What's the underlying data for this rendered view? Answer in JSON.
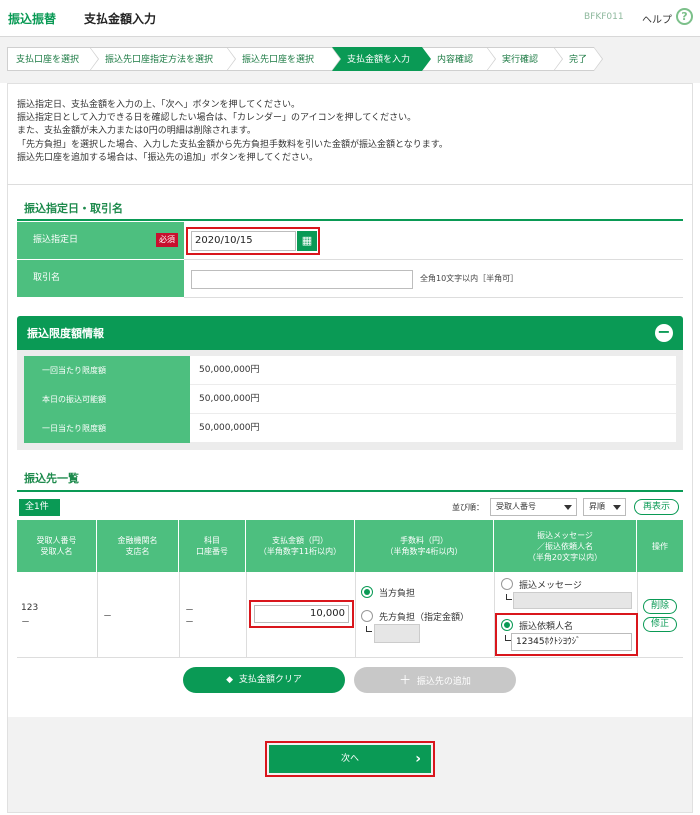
{
  "header": {
    "brand": "振込振替",
    "title": "支払金額入力",
    "screen_id": "BFKF011",
    "help_label": "ヘルプ",
    "help_icon": "?"
  },
  "steps": [
    {
      "label": "支払口座を選択"
    },
    {
      "label": "振込先口座指定方法を選択"
    },
    {
      "label": "振込先口座を選択"
    },
    {
      "label": "支払金額を入力"
    },
    {
      "label": "内容確認"
    },
    {
      "label": "実行確認"
    },
    {
      "label": "完了"
    }
  ],
  "description": [
    "振込指定日、支払金額を入力の上、「次へ」ボタンを押してください。",
    "振込指定日として入力できる日を確認したい場合は、「カレンダー」のアイコンを押してください。",
    "また、支払金額が未入力または0円の明細は削除されます。",
    "「先方負担」を選択した場合、入力した支払金額から先方負担手数料を引いた金額が振込金額となります。",
    "振込先口座を追加する場合は、「振込先の追加」ボタンを押してください。"
  ],
  "date_section": {
    "title": "振込指定日・取引名",
    "date_label": "振込指定日",
    "required_badge": "必須",
    "date_value": "2020/10/15",
    "name_label": "取引名",
    "name_value": "",
    "name_hint": "全角10文字以内［半角可］"
  },
  "limit_section": {
    "title": "振込限度額情報",
    "rows": [
      {
        "label": "一回当たり限度額",
        "value": "50,000,000円"
      },
      {
        "label": "本日の振込可能額",
        "value": "50,000,000円"
      },
      {
        "label": "一日当たり限度額",
        "value": "50,000,000円"
      }
    ]
  },
  "payee_section": {
    "title": "振込先一覧",
    "count": "全1件",
    "sort_label": "並び順：",
    "sort_value": "受取人番号",
    "order_value": "昇順",
    "redisplay_label": "再表示",
    "headers": {
      "col1": [
        "受取人番号",
        "受取人名"
      ],
      "col2": [
        "金融機関名",
        "支店名"
      ],
      "col3": [
        "科目",
        "口座番号"
      ],
      "col4": [
        "支払金額（円）",
        "（半角数字11桁以内）"
      ],
      "col5": [
        "手数料（円）",
        "（半角数字4桁以内）"
      ],
      "col6": [
        "振込メッセージ",
        "／振込依頼人名",
        "（半角20文字以内）"
      ],
      "col7": [
        "操作"
      ]
    },
    "row": {
      "payee_no": "123",
      "payee_name": "－",
      "bank": "－",
      "subject": "－",
      "account_no": "－",
      "amount": "10,000",
      "fee_option_1": "当方負担",
      "fee_option_2": "先方負担（指定金額）",
      "fee_value": "",
      "msg_option_1": "振込メッセージ",
      "msg_value": "",
      "msg_option_2": "振込依頼人名",
      "sender_name": "12345ﾎｸﾄｼﾖｳｼﾞ",
      "delete_label": "削除",
      "edit_label": "修正"
    },
    "clear_button": "支払金額クリア",
    "add_button": "振込先の追加"
  },
  "next_button": "次へ",
  "colors": {
    "accent": "#0a9a55",
    "header_cell": "#4dbf7f",
    "highlight": "#d9161c"
  }
}
